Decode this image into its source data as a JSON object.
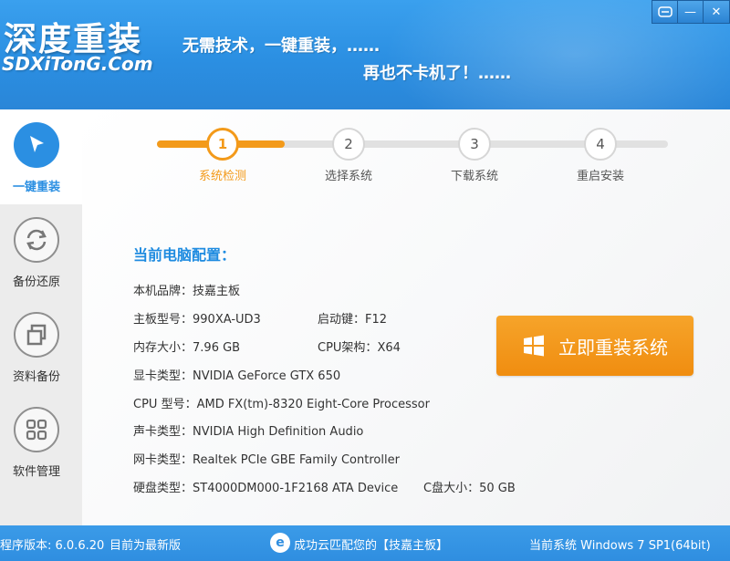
{
  "header": {
    "logo_cn": "深度重装",
    "logo_en": "SDXiTonG.Com",
    "slogan1": "无需技术，一键重装，……",
    "slogan2": "再也不卡机了！……"
  },
  "window_controls": {
    "feedback_icon": "chat-icon",
    "minimize": "—",
    "close": "✕"
  },
  "sidebar": {
    "items": [
      {
        "label": "一键重装",
        "icon": "cursor-icon",
        "active": true
      },
      {
        "label": "备份还原",
        "icon": "refresh-icon",
        "active": false
      },
      {
        "label": "资料备份",
        "icon": "copy-icon",
        "active": false
      },
      {
        "label": "软件管理",
        "icon": "grid-icon",
        "active": false
      }
    ]
  },
  "steps": [
    {
      "num": "1",
      "label": "系统检测"
    },
    {
      "num": "2",
      "label": "选择系统"
    },
    {
      "num": "3",
      "label": "下载系统"
    },
    {
      "num": "4",
      "label": "重启安装"
    }
  ],
  "config": {
    "title": "当前电脑配置：",
    "brand": {
      "k": "本机品牌：",
      "v": "技嘉主板"
    },
    "board": {
      "k": "主板型号：",
      "v": "990XA-UD3"
    },
    "boot_key": {
      "k": "启动键：",
      "v": "F12"
    },
    "memory": {
      "k": "内存大小：",
      "v": "7.96 GB"
    },
    "cpu_arch": {
      "k": "CPU架构：",
      "v": "X64"
    },
    "gpu": {
      "k": "显卡类型：",
      "v": "NVIDIA GeForce GTX 650"
    },
    "cpu": {
      "k": "CPU 型号：",
      "v": "AMD FX(tm)-8320 Eight-Core Processor"
    },
    "audio": {
      "k": "声卡类型：",
      "v": "NVIDIA High Definition Audio"
    },
    "network": {
      "k": "网卡类型：",
      "v": "Realtek PCIe GBE Family Controller"
    },
    "disk": {
      "k": "硬盘类型：",
      "v": "ST4000DM000-1F2168 ATA Device"
    },
    "c_drive": {
      "k": "C盘大小：",
      "v": "50 GB"
    }
  },
  "install_button": "立即重装系统",
  "statusbar": {
    "version": "程序版本: 6.0.6.20",
    "latest": "目前为最新版",
    "cloud_match": "成功云匹配您的【技嘉主板】",
    "current_system": "当前系统 Windows 7 SP1(64bit)"
  },
  "colors": {
    "header_blue": "#2b8fe2",
    "accent_orange": "#f39a1a",
    "title_blue": "#1e8be0"
  }
}
